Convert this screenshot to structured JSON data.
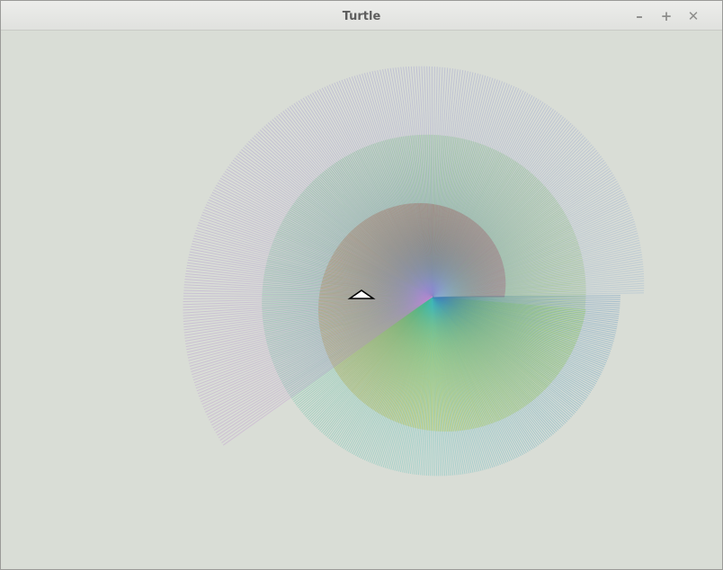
{
  "window": {
    "title": "Turtle",
    "minimize_glyph": "–",
    "maximize_glyph": "+",
    "close_glyph": "✕"
  },
  "canvas": {
    "background": "#d9ddd6"
  },
  "drawing": {
    "style": "spiral fan of colored radial lines",
    "center_color": "#d23ca0",
    "turtle_color": "#ffffff",
    "turtle_outline": "#000000"
  }
}
